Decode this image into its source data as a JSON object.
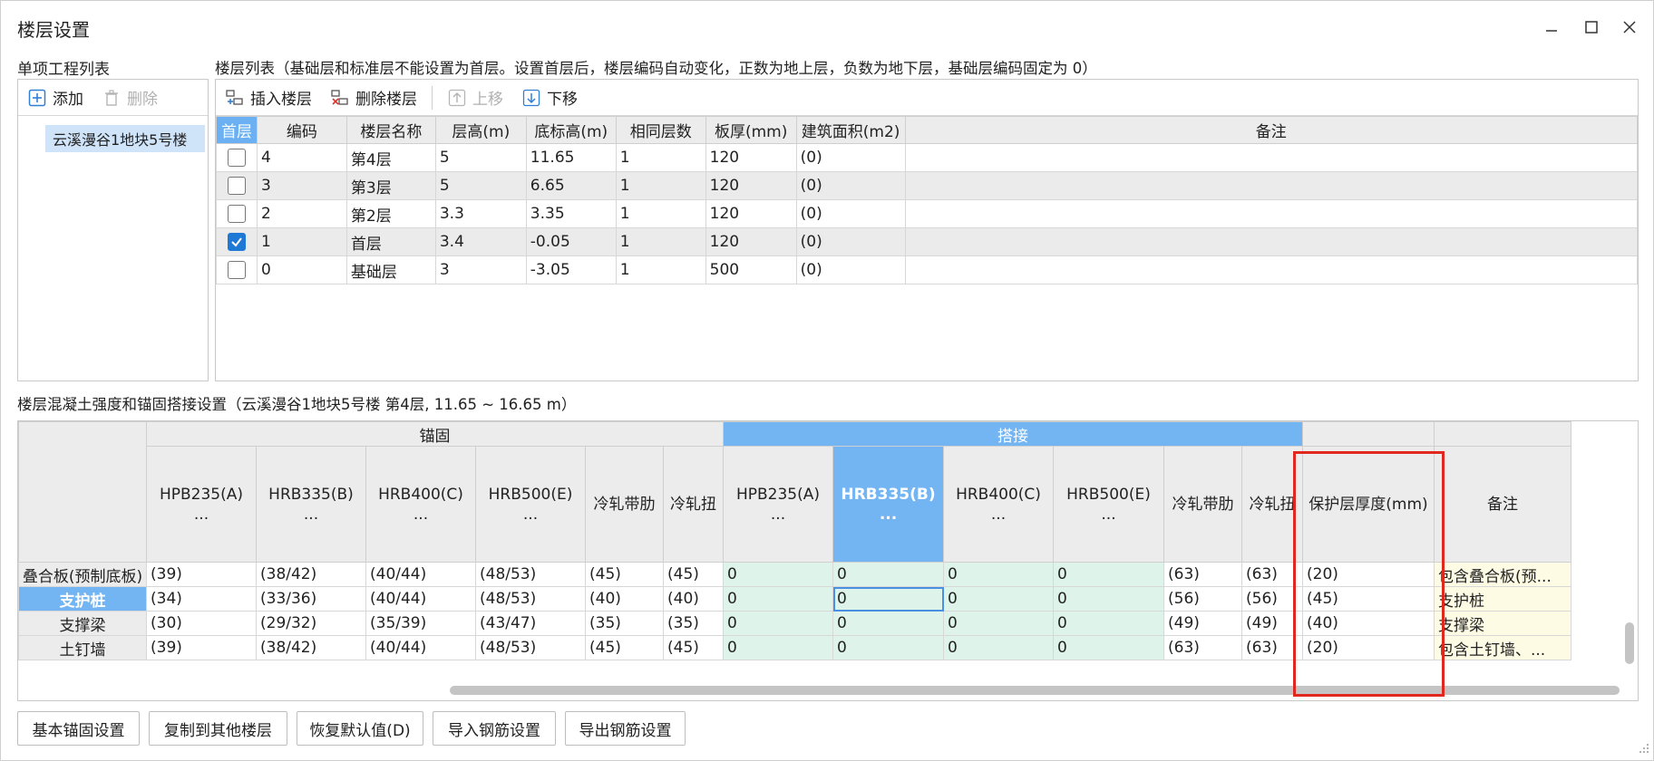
{
  "window": {
    "title": "楼层设置"
  },
  "left_panel": {
    "label": "单项工程列表",
    "add_label": "添加",
    "delete_label": "删除",
    "items": [
      "云溪漫谷1地块5号楼"
    ]
  },
  "floor_panel": {
    "label": "楼层列表（基础层和标准层不能设置为首层。设置首层后，楼层编码自动变化，正数为地上层，负数为地下层，基础层编码固定为 0）",
    "toolbar": {
      "insert": "插入楼层",
      "delete": "删除楼层",
      "up": "上移",
      "down": "下移"
    },
    "columns": [
      "首层",
      "编码",
      "楼层名称",
      "层高(m)",
      "底标高(m)",
      "相同层数",
      "板厚(mm)",
      "建筑面积(m2)",
      "备注"
    ],
    "rows": [
      {
        "checked": false,
        "code": "4",
        "name": "第4层",
        "height": "5",
        "bottom": "11.65",
        "same": "1",
        "thick": "120",
        "area": "(0)",
        "note": ""
      },
      {
        "checked": false,
        "code": "3",
        "name": "第3层",
        "height": "5",
        "bottom": "6.65",
        "same": "1",
        "thick": "120",
        "area": "(0)",
        "note": ""
      },
      {
        "checked": false,
        "code": "2",
        "name": "第2层",
        "height": "3.3",
        "bottom": "3.35",
        "same": "1",
        "thick": "120",
        "area": "(0)",
        "note": ""
      },
      {
        "checked": true,
        "code": "1",
        "name": "首层",
        "height": "3.4",
        "bottom": "-0.05",
        "same": "1",
        "thick": "120",
        "area": "(0)",
        "note": ""
      },
      {
        "checked": false,
        "code": "0",
        "name": "基础层",
        "height": "3",
        "bottom": "-3.05",
        "same": "1",
        "thick": "500",
        "area": "(0)",
        "note": ""
      }
    ]
  },
  "rebar_panel": {
    "label": "楼层混凝土强度和锚固搭接设置（云溪漫谷1地块5号楼   第4层, 11.65 ~ 16.65 m）",
    "group_anchor": "锚固",
    "group_lap": "搭接",
    "col_headers": [
      {
        "line1": "HPB235(A)",
        "line2": "..."
      },
      {
        "line1": "HRB335(B)",
        "line2": "..."
      },
      {
        "line1": "HRB400(C)",
        "line2": "..."
      },
      {
        "line1": "HRB500(E)",
        "line2": "..."
      },
      {
        "line1": "冷轧带肋",
        "line2": ""
      },
      {
        "line1": "冷轧扭",
        "line2": ""
      },
      {
        "line1": "HPB235(A)",
        "line2": "..."
      },
      {
        "line1": "HRB335(B)",
        "line2": "..."
      },
      {
        "line1": "HRB400(C)",
        "line2": "..."
      },
      {
        "line1": "HRB500(E)",
        "line2": "..."
      },
      {
        "line1": "冷轧带肋",
        "line2": ""
      },
      {
        "line1": "冷轧扭",
        "line2": ""
      },
      {
        "line1": "保护层厚度(mm)",
        "line2": ""
      },
      {
        "line1": "备注",
        "line2": ""
      }
    ],
    "rows": [
      {
        "name": "叠合板(预制底板)",
        "cells": [
          "(39)",
          "(38/42)",
          "(40/44)",
          "(48/53)",
          "(45)",
          "(45)",
          "0",
          "0",
          "0",
          "0",
          "(63)",
          "(63)",
          "(20)",
          "包含叠合板(预..."
        ]
      },
      {
        "name": "支护桩",
        "cells": [
          "(34)",
          "(33/36)",
          "(40/44)",
          "(48/53)",
          "(40)",
          "(40)",
          "0",
          "0",
          "0",
          "0",
          "(56)",
          "(56)",
          "(45)",
          "支护桩"
        ]
      },
      {
        "name": "支撑梁",
        "cells": [
          "(30)",
          "(29/32)",
          "(35/39)",
          "(43/47)",
          "(35)",
          "(35)",
          "0",
          "0",
          "0",
          "0",
          "(49)",
          "(49)",
          "(40)",
          "支撑梁"
        ]
      },
      {
        "name": "土钉墙",
        "cells": [
          "(39)",
          "(38/42)",
          "(40/44)",
          "(48/53)",
          "(45)",
          "(45)",
          "0",
          "0",
          "0",
          "0",
          "(63)",
          "(63)",
          "(20)",
          "包含土钉墙、..."
        ]
      }
    ]
  },
  "bottom_buttons": [
    "基本锚固设置",
    "复制到其他楼层",
    "恢复默认值(D)",
    "导入钢筋设置",
    "导出钢筋设置"
  ]
}
